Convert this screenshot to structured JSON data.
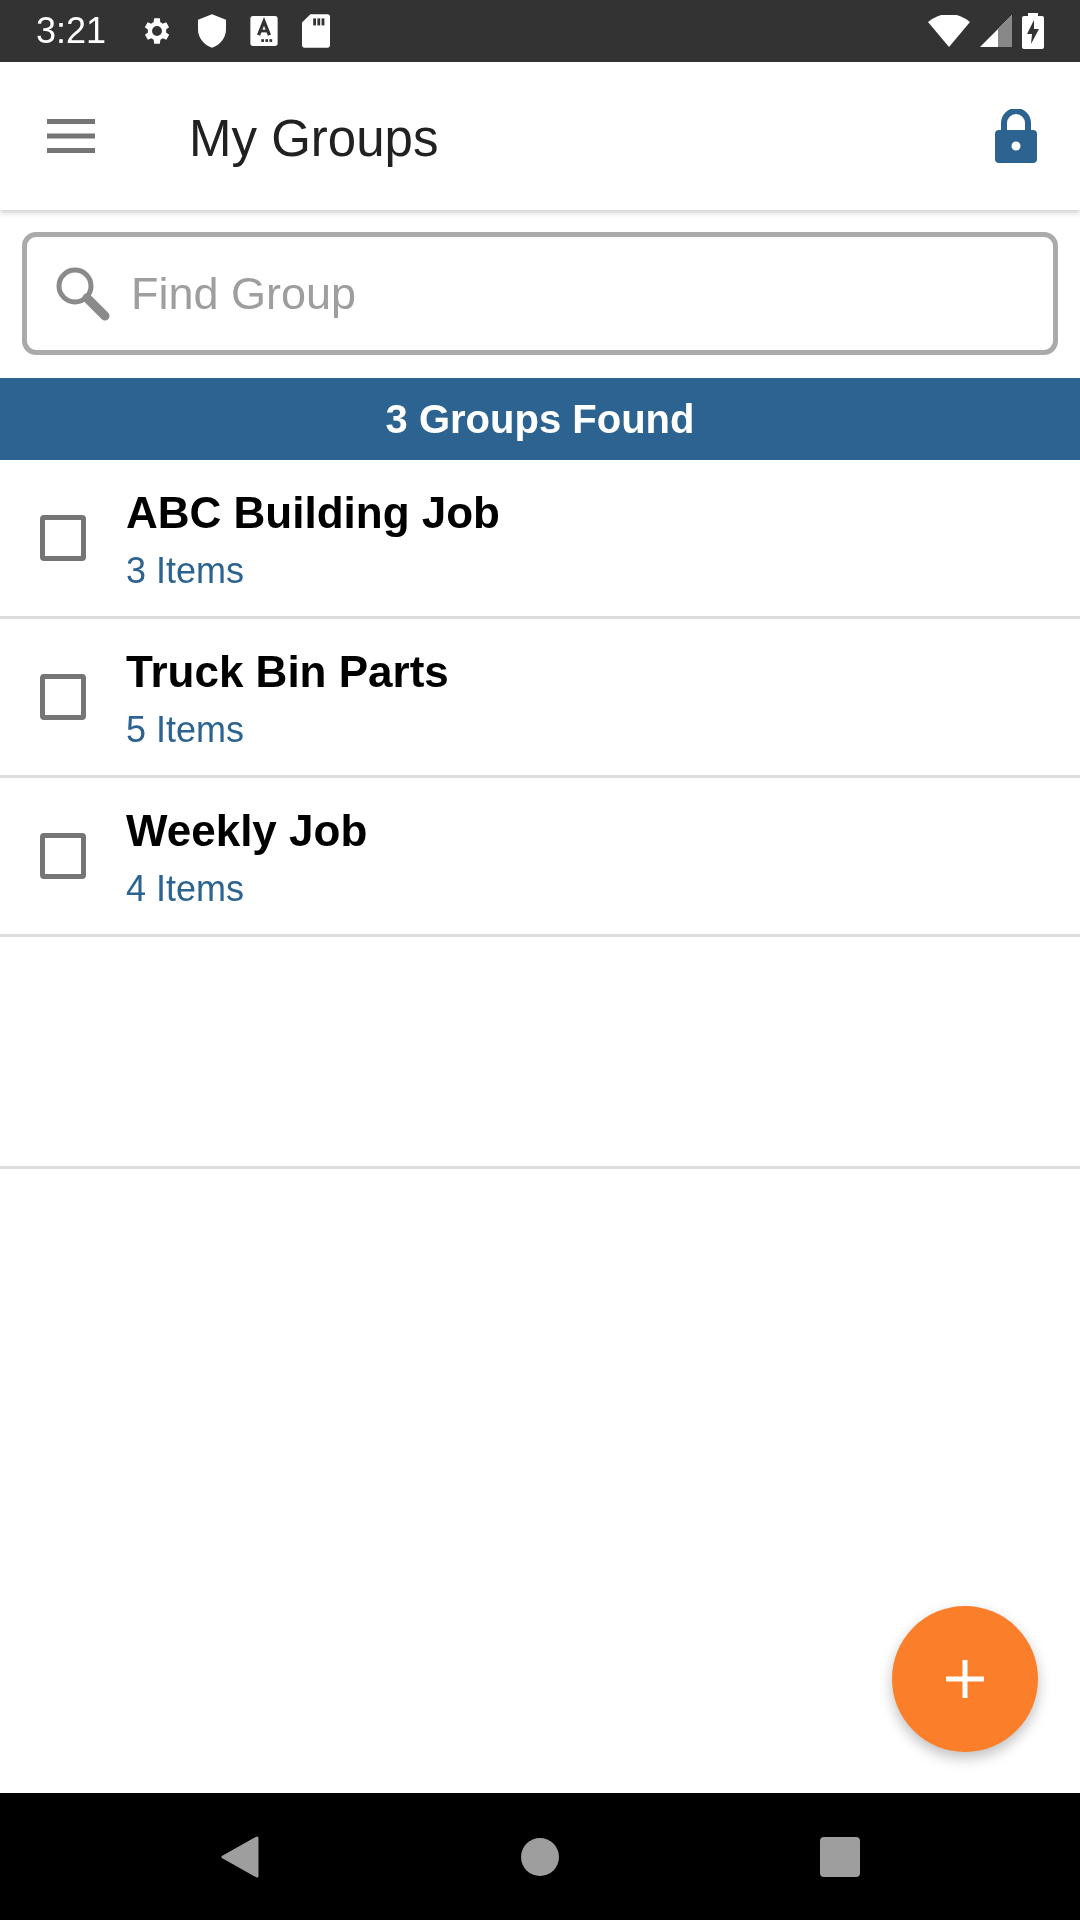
{
  "status_bar": {
    "time": "3:21"
  },
  "app_bar": {
    "title": "My Groups"
  },
  "search": {
    "placeholder": "Find Group"
  },
  "results_banner": {
    "text": "3 Groups Found"
  },
  "groups": [
    {
      "name": "ABC Building Job",
      "count": "3 Items",
      "checked": false
    },
    {
      "name": "Truck Bin Parts",
      "count": "5 Items",
      "checked": false
    },
    {
      "name": "Weekly Job",
      "count": "4 Items",
      "checked": false
    }
  ]
}
